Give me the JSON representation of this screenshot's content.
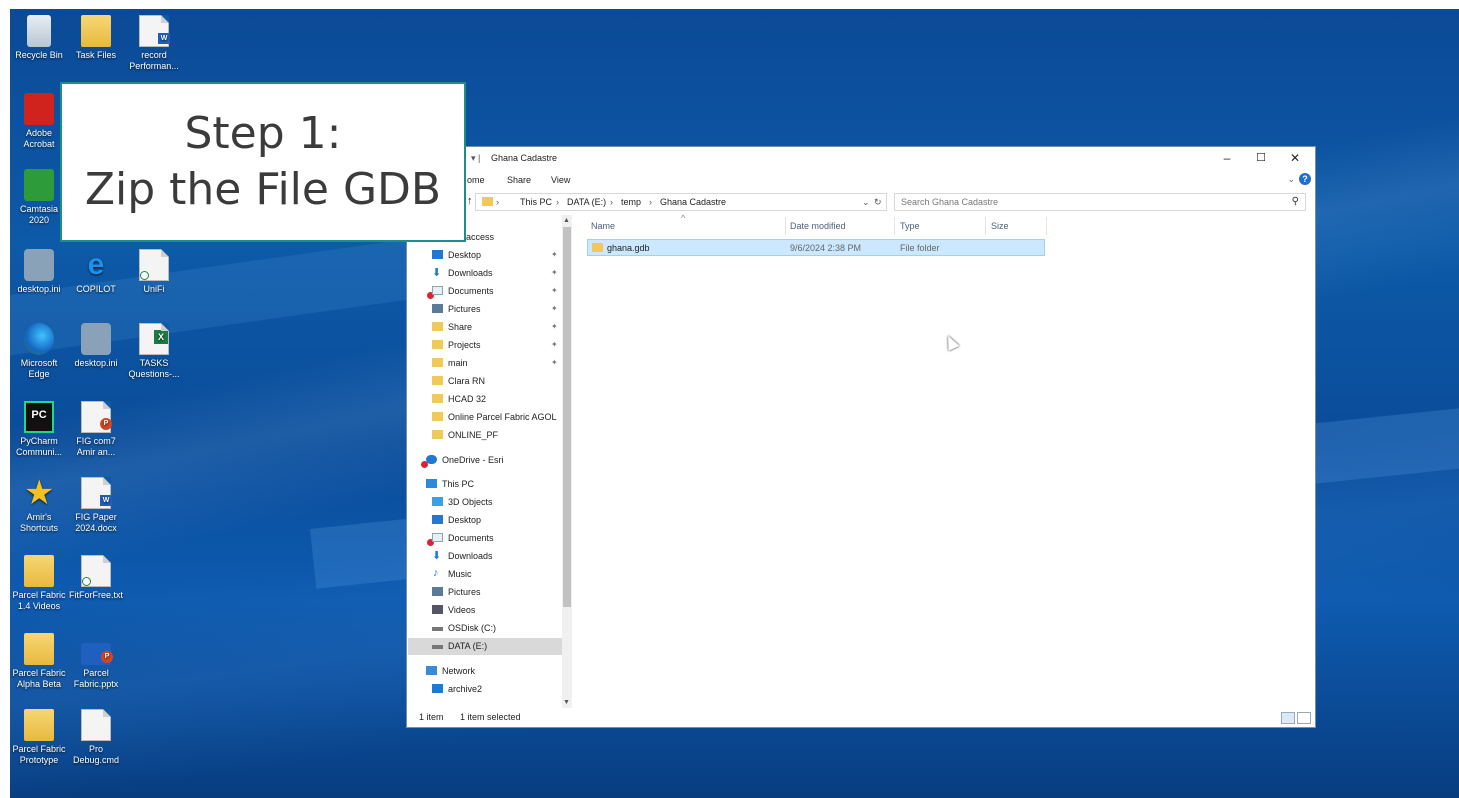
{
  "desktop": {
    "icons": [
      {
        "label": "Recycle Bin",
        "icon": "recycle-bin-icon"
      },
      {
        "label": "Task Files",
        "icon": "folder-icon"
      },
      {
        "label": "record Performan...",
        "icon": "word-document-icon"
      },
      {
        "label": "Adobe Acrobat",
        "icon": "acrobat-icon"
      },
      {
        "label": "Camtasia 2020",
        "icon": "camtasia-icon"
      },
      {
        "label": "desktop.ini",
        "icon": "settings-file-icon"
      },
      {
        "label": "COPILOT",
        "icon": "internet-explorer-icon"
      },
      {
        "label": "UniFi",
        "icon": "file-icon"
      },
      {
        "label": "Microsoft Edge",
        "icon": "edge-icon"
      },
      {
        "label": "desktop.ini",
        "icon": "settings-file-icon"
      },
      {
        "label": "TASKS Questions-...",
        "icon": "excel-icon"
      },
      {
        "label": "PyCharm Communi...",
        "icon": "pycharm-icon"
      },
      {
        "label": "FIG com7 Amir an...",
        "icon": "powerpoint-icon"
      },
      {
        "label": "Amir's Shortcuts",
        "icon": "star-icon"
      },
      {
        "label": "FIG Paper 2024.docx",
        "icon": "word-document-icon"
      },
      {
        "label": "Parcel Fabric 1.4 Videos",
        "icon": "folder-icon"
      },
      {
        "label": "FitForFree.txt",
        "icon": "text-file-icon"
      },
      {
        "label": "Parcel Fabric Alpha Beta",
        "icon": "folder-icon"
      },
      {
        "label": "Parcel Fabric.pptx",
        "icon": "powerpoint-icon"
      },
      {
        "label": "Parcel Fabric Prototype",
        "icon": "folder-icon"
      },
      {
        "label": "Pro Debug.cmd",
        "icon": "file-icon"
      }
    ]
  },
  "callout": {
    "line1": "Step 1:",
    "line2": "Zip the File GDB"
  },
  "explorer": {
    "title": "Ghana Cadastre",
    "ribbon": {
      "home": "ome",
      "share": "Share",
      "view": "View"
    },
    "address": {
      "this_pc": "This PC",
      "drive": "DATA (E:)",
      "temp": "temp",
      "folder": "Ghana Cadastre"
    },
    "search_placeholder": "Search Ghana Cadastre",
    "nav": {
      "quick_access": "access",
      "quick": [
        "Desktop",
        "Downloads",
        "Documents",
        "Pictures",
        "Share",
        "Projects",
        "main",
        "Clara RN",
        "HCAD 32",
        "Online Parcel Fabric AGOL",
        "ONLINE_PF"
      ],
      "onedrive": "OneDrive - Esri",
      "this_pc": "This PC",
      "pc_items": [
        "3D Objects",
        "Desktop",
        "Documents",
        "Downloads",
        "Music",
        "Pictures",
        "Videos",
        "OSDisk (C:)",
        "DATA (E:)"
      ],
      "network": "Network",
      "network_items": [
        "archive2"
      ]
    },
    "columns": {
      "name": "Name",
      "date": "Date modified",
      "type": "Type",
      "size": "Size"
    },
    "files": [
      {
        "name": "ghana.gdb",
        "date": "9/6/2024 2:38 PM",
        "type": "File folder",
        "size": ""
      }
    ],
    "status": {
      "count": "1 item",
      "selected": "1 item selected"
    }
  }
}
